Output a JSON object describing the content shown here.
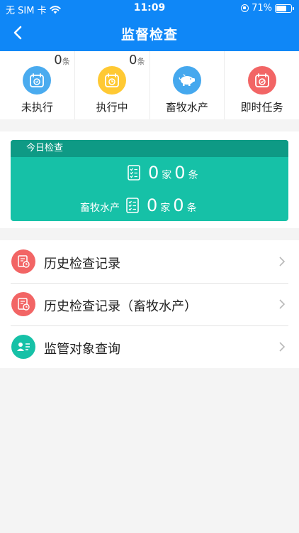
{
  "status_bar": {
    "carrier": "无 SIM 卡",
    "time": "11:09",
    "battery": "71%",
    "battery_level": 0.71
  },
  "header": {
    "title": "监督检查",
    "color": "#0f87f7"
  },
  "grid": [
    {
      "label": "未执行",
      "count": "0",
      "unit": "条",
      "icon": "calendar-pending-icon",
      "color": "#4aabef"
    },
    {
      "label": "执行中",
      "count": "0",
      "unit": "条",
      "icon": "calendar-clock-icon",
      "color": "#ffc933"
    },
    {
      "label": "畜牧水产",
      "icon": "pig-icon",
      "color": "#45a8ee"
    },
    {
      "label": "即时任务",
      "icon": "calendar-check-icon",
      "color": "#f26565"
    }
  ],
  "today": {
    "header": "今日检查",
    "row1": {
      "homes": "0",
      "home_unit": "家",
      "items": "0",
      "item_unit": "条"
    },
    "row2": {
      "label": "畜牧水产",
      "homes": "0",
      "home_unit": "家",
      "items": "0",
      "item_unit": "条"
    },
    "color": "#16c1a7"
  },
  "list": [
    {
      "label": "历史检查记录",
      "icon": "record-history-icon",
      "color": "#f26565"
    },
    {
      "label": "历史检查记录（畜牧水产）",
      "icon": "record-history-icon",
      "color": "#f26565"
    },
    {
      "label": "监管对象查询",
      "icon": "id-card-icon",
      "color": "#16c1a7"
    }
  ]
}
